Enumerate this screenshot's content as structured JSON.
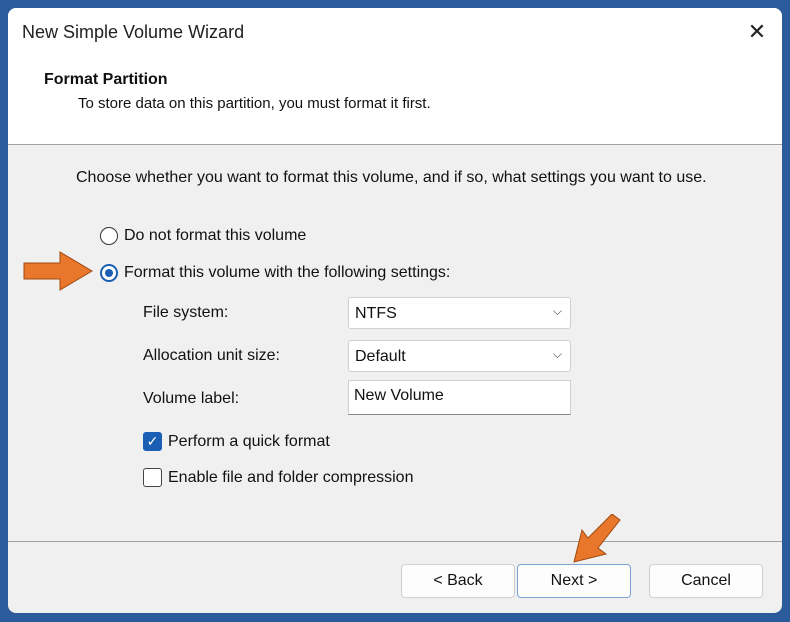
{
  "window": {
    "title": "New Simple Volume Wizard",
    "close_icon": "close-icon"
  },
  "header": {
    "heading": "Format Partition",
    "subheading": "To store data on this partition, you must format it first."
  },
  "body": {
    "instruction": "Choose whether you want to format this volume, and if so, what settings you want to use.",
    "option_no_format": "Do not format this volume",
    "option_format": "Format this volume with the following settings:",
    "selected_option": "format",
    "file_system_label": "File system:",
    "file_system_value": "NTFS",
    "alloc_label": "Allocation unit size:",
    "alloc_value": "Default",
    "volume_label_label": "Volume label:",
    "volume_label_value": "New Volume",
    "quick_format_label": "Perform a quick format",
    "quick_format_checked": true,
    "compression_label": "Enable file and folder compression",
    "compression_checked": false
  },
  "footer": {
    "back": "< Back",
    "next": "Next >",
    "cancel": "Cancel"
  },
  "colors": {
    "accent": "#1a5fb4",
    "arrow": "#e8762b",
    "background": "#2c5b9c"
  }
}
